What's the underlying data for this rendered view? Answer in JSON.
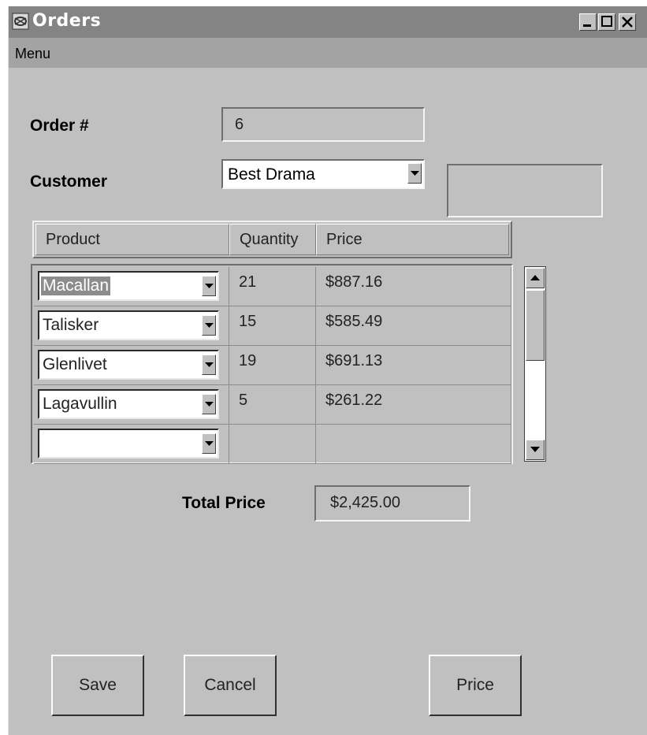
{
  "window": {
    "title": "Orders",
    "controls": [
      "minimize",
      "maximize",
      "close"
    ]
  },
  "menubar": {
    "items": [
      {
        "label": "Menu"
      }
    ]
  },
  "form": {
    "order_label": "Order #",
    "order_value": "6",
    "customer_label": "Customer",
    "customer_value": "Best Drama",
    "customer_extra_value": ""
  },
  "table": {
    "columns": [
      "Product",
      "Quantity",
      "Price"
    ],
    "rows": [
      {
        "product": "Macallan",
        "quantity": "21",
        "price": "$887.16",
        "selected": true
      },
      {
        "product": "Talisker",
        "quantity": "15",
        "price": "$585.49"
      },
      {
        "product": "Glenlivet",
        "quantity": "19",
        "price": "$691.13"
      },
      {
        "product": "Lagavullin",
        "quantity": "5",
        "price": "$261.22"
      },
      {
        "product": "",
        "quantity": "",
        "price": ""
      }
    ]
  },
  "total": {
    "label": "Total Price",
    "value": "$2,425.00"
  },
  "buttons": {
    "save": "Save",
    "cancel": "Cancel",
    "price": "Price"
  },
  "icons": {
    "app": "app-icon",
    "dropdown": "chevron-down-icon",
    "scroll_up": "arrow-up-icon",
    "scroll_down": "arrow-down-icon"
  }
}
